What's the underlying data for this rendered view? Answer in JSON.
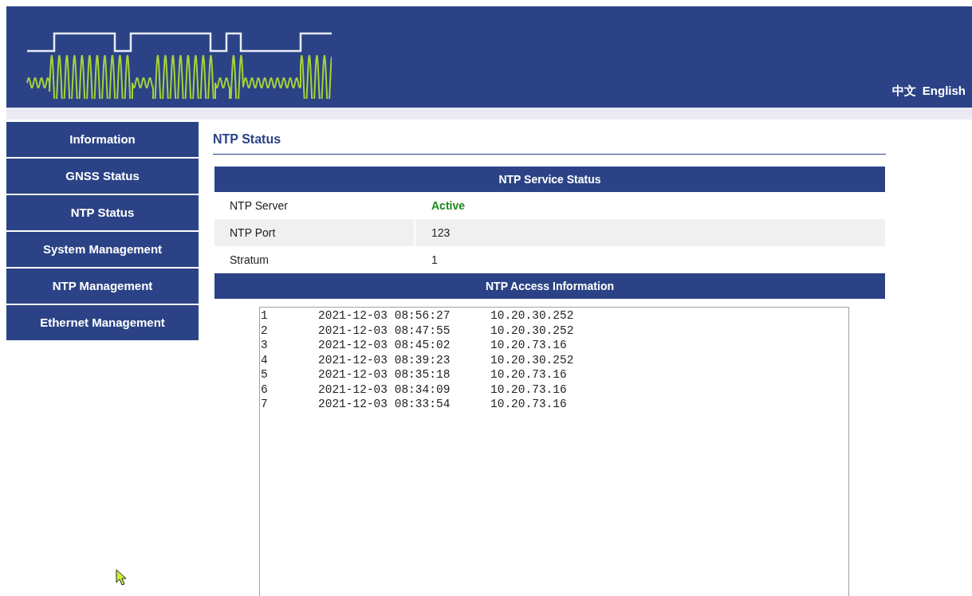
{
  "header": {
    "languages": [
      "中文",
      "English"
    ]
  },
  "sidebar": {
    "items": [
      {
        "label": "Information"
      },
      {
        "label": "GNSS Status"
      },
      {
        "label": "NTP Status"
      },
      {
        "label": "System Management"
      },
      {
        "label": "NTP Management"
      },
      {
        "label": "Ethernet Management"
      }
    ]
  },
  "page_title": "NTP Status",
  "service_status": {
    "title": "NTP Service Status",
    "rows": [
      {
        "label": "NTP Server",
        "value": "Active",
        "kind": "status"
      },
      {
        "label": "NTP Port",
        "value": "123",
        "kind": "plain"
      },
      {
        "label": "Stratum",
        "value": "1",
        "kind": "plain"
      }
    ]
  },
  "access_information": {
    "title": "NTP Access Information",
    "entries": [
      {
        "number": "1",
        "time": "2021-12-03 08:56:27",
        "ip": "10.20.30.252"
      },
      {
        "number": "2",
        "time": "2021-12-03 08:47:55",
        "ip": "10.20.30.252"
      },
      {
        "number": "3",
        "time": "2021-12-03 08:45:02",
        "ip": "10.20.73.16"
      },
      {
        "number": "4",
        "time": "2021-12-03 08:39:23",
        "ip": "10.20.30.252"
      },
      {
        "number": "5",
        "time": "2021-12-03 08:35:18",
        "ip": "10.20.73.16"
      },
      {
        "number": "6",
        "time": "2021-12-03 08:34:09",
        "ip": "10.20.73.16"
      },
      {
        "number": "7",
        "time": "2021-12-03 08:33:54",
        "ip": "10.20.73.16"
      }
    ]
  }
}
